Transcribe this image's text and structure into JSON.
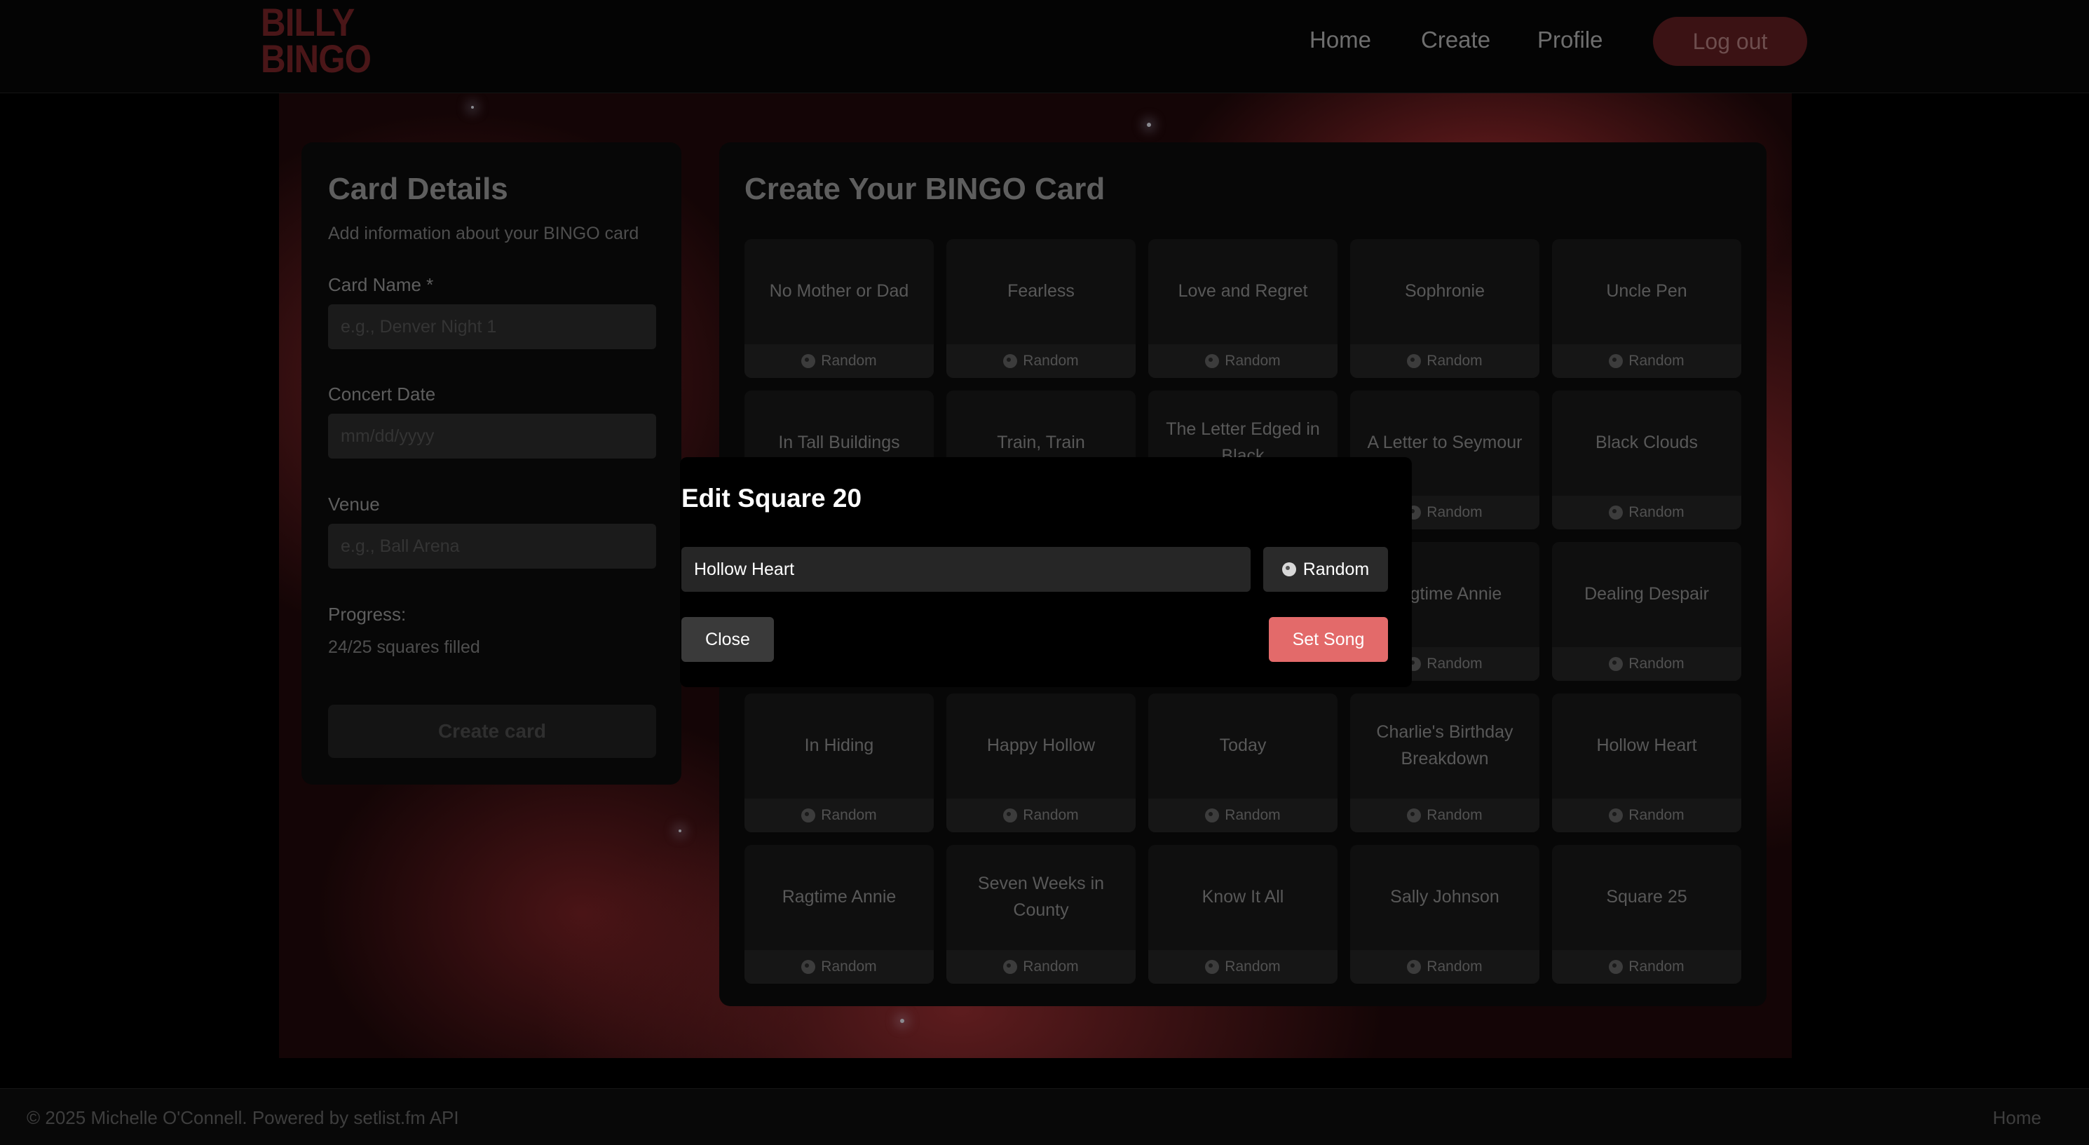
{
  "header": {
    "logo_line1": "BILLY",
    "logo_line2": "BINGO",
    "nav": [
      "Home",
      "Create",
      "Profile"
    ],
    "logout_label": "Log out"
  },
  "details": {
    "title": "Card Details",
    "subtitle": "Add information about your BINGO card",
    "card_name_label": "Card Name *",
    "card_name_placeholder": "e.g., Denver Night 1",
    "date_label": "Concert Date",
    "date_placeholder": "mm/dd/yyyy",
    "venue_label": "Venue",
    "venue_placeholder": "e.g., Ball Arena",
    "progress_label": "Progress:",
    "progress_text": "24/25 squares filled",
    "create_label": "Create card"
  },
  "card": {
    "title": "Create Your BINGO Card",
    "random_label": "Random",
    "squares": [
      "No Mother or Dad",
      "Fearless",
      "Love and Regret",
      "Sophronie",
      "Uncle Pen",
      "In Tall Buildings",
      "Train, Train",
      "The Letter Edged in Black",
      "A Letter to Seymour",
      "Black Clouds",
      "",
      "",
      "",
      "Ragtime Annie",
      "Dealing Despair",
      "In Hiding",
      "Happy Hollow",
      "Today",
      "Charlie's Birthday Breakdown",
      "Hollow Heart",
      "Ragtime Annie",
      "Seven Weeks in County",
      "Know It All",
      "Sally Johnson",
      "Square 25"
    ]
  },
  "modal": {
    "title": "Edit Square 20",
    "input_value": "Hollow Heart",
    "random_label": "Random",
    "close_label": "Close",
    "set_label": "Set Song"
  },
  "footer": {
    "copyright": "© 2025 Michelle O'Connell. Powered by setlist.fm API",
    "home_link": "Home"
  },
  "colors": {
    "accent": "#e36a6a",
    "logo": "#4a1618",
    "background": "#000000"
  },
  "icons": {
    "random": "dice-icon"
  }
}
